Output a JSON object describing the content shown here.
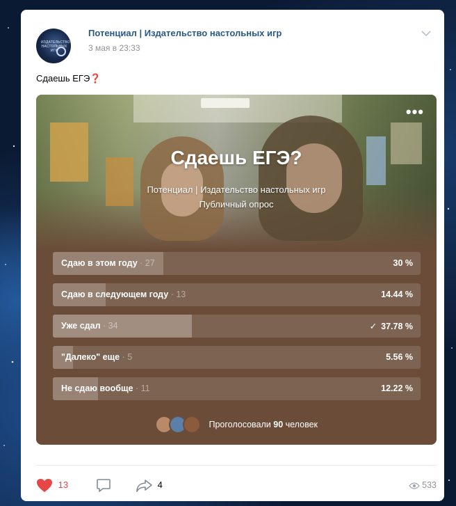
{
  "post": {
    "author": "Потенциал | Издательство настольных игр",
    "date": "3 мая в 23:33",
    "text": "Сдаешь ЕГЭ",
    "text_emoji": "❓",
    "avatar_text": "ИЗДАТЕЛЬСТВО НАСТОЛЬНЫХ ИГР"
  },
  "poll": {
    "title": "Сдаешь ЕГЭ?",
    "author": "Потенциал | Издательство настольных игр",
    "type": "Публичный опрос",
    "menu": "•••",
    "options": [
      {
        "label": "Сдаю в этом году",
        "count": "· 27",
        "percent": "30 %",
        "fraction": 0.3,
        "chosen": false
      },
      {
        "label": "Сдаю в следующем году",
        "count": "· 13",
        "percent": "14.44 %",
        "fraction": 0.1444,
        "chosen": false
      },
      {
        "label": "Уже сдал",
        "count": "· 34",
        "percent": "37.78 %",
        "fraction": 0.3778,
        "chosen": true,
        "check": "✓"
      },
      {
        "label": "\"Далеко\" еще",
        "count": "· 5",
        "percent": "5.56 %",
        "fraction": 0.0556,
        "chosen": false
      },
      {
        "label": "Не сдаю вообще",
        "count": "· 11",
        "percent": "12.22 %",
        "fraction": 0.1222,
        "chosen": false
      }
    ],
    "voted_prefix": "Проголосовали ",
    "voted_count": "90",
    "voted_suffix": " человек"
  },
  "actions": {
    "likes": "13",
    "shares": "4",
    "views": "533"
  },
  "colors": {
    "link": "#2a5885",
    "like": "#e64646",
    "poll_bg": "#6a4c38"
  }
}
